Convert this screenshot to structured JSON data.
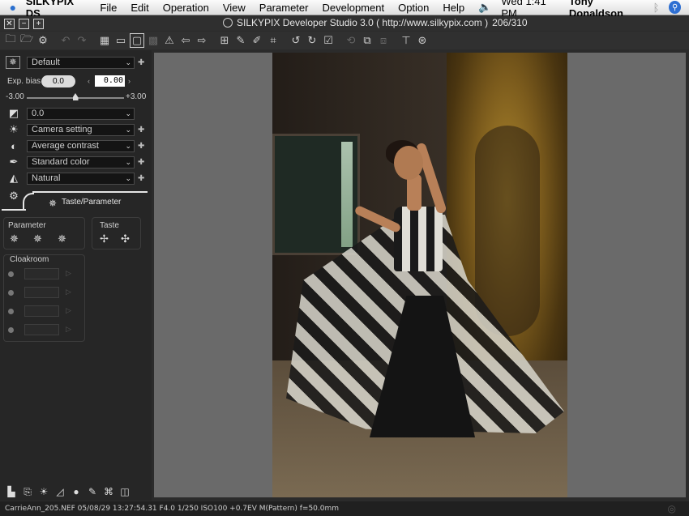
{
  "menubar": {
    "app_name": "SILKYPIX DS",
    "items": [
      "File",
      "Edit",
      "Operation",
      "View",
      "Parameter",
      "Development",
      "Option",
      "Help"
    ],
    "clock": "Wed 1:41 PM",
    "user": "Tony Donaldson",
    "volume_icon": "volume-icon",
    "bluetooth_icon": "bluetooth-icon",
    "spotlight_icon": "spotlight-icon"
  },
  "window": {
    "title": "SILKYPIX Developer Studio 3.0 ( http://www.silkypix.com )",
    "counter": "206/310"
  },
  "panel": {
    "preset_label": "Default",
    "exp_bias_label": "Exp. bias",
    "exp_bias_value": "0.0",
    "exp_bias_field": "0.00",
    "range_min": "-3.00",
    "range_max": "+3.00",
    "slider_fraction": 0.5,
    "contrast_value": "0.0",
    "white_balance": "Camera setting",
    "tone": "Average contrast",
    "color": "Standard color",
    "sharpness": "Natural",
    "tab_label": "Taste/Parameter",
    "parameter_group": "Parameter",
    "taste_group": "Taste",
    "cloakroom_group": "Cloakroom"
  },
  "status": {
    "text": "CarrieAnn_205.NEF 05/08/29 13:27:54.31 F4.0 1/250 ISO100 +0.7EV M(Pattern) f=50.0mm"
  }
}
